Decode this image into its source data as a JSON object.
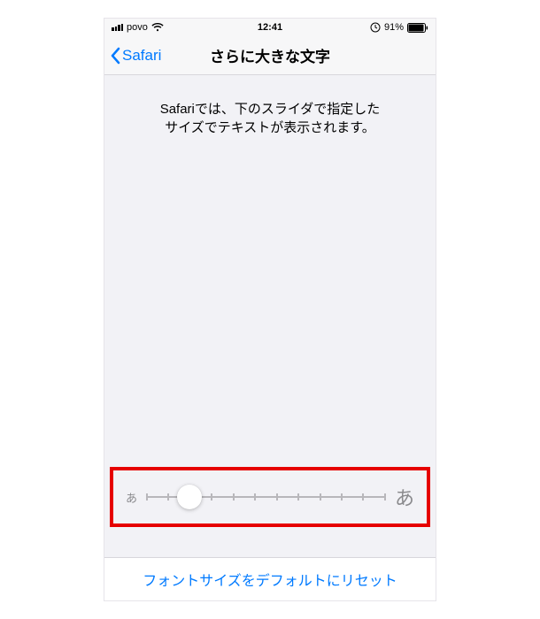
{
  "statusbar": {
    "carrier": "povo",
    "time": "12:41",
    "battery_pct": "91%"
  },
  "navbar": {
    "back_label": "Safari",
    "title": "さらに大きな文字"
  },
  "description": {
    "line1": "Safariでは、下のスライダで指定した",
    "line2": "サイズでテキストが表示されます。"
  },
  "slider": {
    "small_label": "あ",
    "large_label": "あ",
    "ticks": 12,
    "position_index": 2,
    "thumb_left_pct": "18.2%"
  },
  "footer": {
    "reset_label": "フォントサイズをデフォルトにリセット"
  },
  "colors": {
    "tint": "#007aff",
    "highlight": "#e60000"
  }
}
